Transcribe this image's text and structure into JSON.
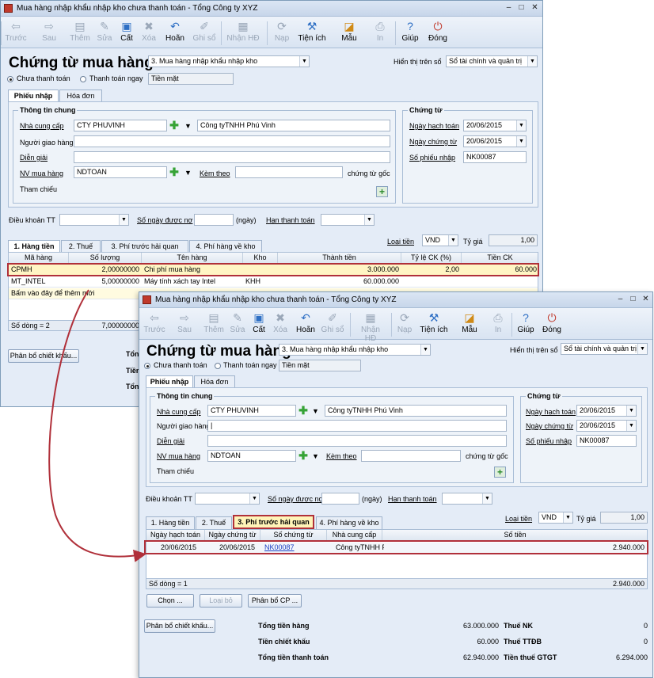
{
  "window_title": "Mua hàng nhập khẩu nhập kho chưa thanh toán - Tổng Công ty XYZ",
  "toolbar": [
    {
      "label": "Trước",
      "icon": "arrow-left-icon",
      "enabled": false
    },
    {
      "label": "Sau",
      "icon": "arrow-right-icon",
      "enabled": false
    },
    {
      "label": "Thêm",
      "icon": "new-document-icon",
      "enabled": false
    },
    {
      "label": "Sửa",
      "icon": "edit-icon",
      "enabled": false
    },
    {
      "label": "Cất",
      "icon": "save-icon",
      "enabled": true
    },
    {
      "label": "Xóa",
      "icon": "delete-icon",
      "enabled": false
    },
    {
      "label": "Hoãn",
      "icon": "undo-icon",
      "enabled": true
    },
    {
      "label": "Ghi sổ",
      "icon": "post-icon",
      "enabled": false
    },
    {
      "label": "Nhận HĐ",
      "icon": "receive-invoice-icon",
      "enabled": false
    },
    {
      "label": "Nạp",
      "icon": "reload-icon",
      "enabled": false
    },
    {
      "label": "Tiện ích",
      "icon": "utilities-icon",
      "enabled": true
    },
    {
      "label": "Mẫu",
      "icon": "template-icon",
      "enabled": true
    },
    {
      "label": "In",
      "icon": "print-icon",
      "enabled": false
    },
    {
      "label": "Giúp",
      "icon": "help-icon",
      "enabled": true
    },
    {
      "label": "Đóng",
      "icon": "close-icon",
      "enabled": true
    }
  ],
  "form": {
    "title": "Chứng từ mua hàng",
    "type_value": "3. Mua hàng nhập khẩu nhập kho",
    "display_label": "Hiển thị trên sổ",
    "display_value": "Sổ tài chính và quản trị",
    "radio_unpaid": "Chưa thanh toán",
    "radio_paid": "Thanh toán ngay",
    "payment_method": "Tiền mặt",
    "tab_receipt": "Phiếu nhập",
    "tab_invoice": "Hóa đơn",
    "general_info": "Thông tin chung",
    "voucher_group": "Chứng từ",
    "supplier_label": "Nhà cung cấp",
    "supplier_code": "CTY PHUVINH",
    "supplier_name": "Công tyTNHH Phú Vinh",
    "deliverer_label": "Người giao hàng",
    "description_label": "Diễn giải",
    "staff_label": "NV mua hàng",
    "staff_value": "NDTOAN",
    "attach_label": "Kèm theo",
    "original_docs_label": "chứng từ gốc",
    "reference_label": "Tham chiếu",
    "accounting_date_label": "Ngày hạch toán",
    "accounting_date": "20/06/2015",
    "voucher_date_label": "Ngày chứng từ",
    "voucher_date": "20/06/2015",
    "receipt_no_label": "Số phiếu nhập",
    "receipt_no": "NK00087",
    "terms_label": "Điều khoản TT",
    "credit_days_label": "Số ngày được nợ",
    "days_unit": "(ngày)",
    "due_date_label": "Hạn thanh toán",
    "currency_label": "Loại tiền",
    "currency": "VND",
    "rate_label": "Tỷ giá",
    "rate": "1,00"
  },
  "detail_tabs": [
    "1. Hàng tiền",
    "2. Thuế",
    "3. Phí trước hải quan",
    "4. Phí hàng về kho"
  ],
  "goods_grid": {
    "headers": [
      "Mã hàng",
      "Số lượng",
      "Tên hàng",
      "Kho",
      "Thành tiền",
      "Tỷ lệ CK (%)",
      "Tiền CK"
    ],
    "rows": [
      [
        "CPMH",
        "2,00000000",
        "Chi phí mua hàng",
        "",
        "3.000.000",
        "2,00",
        "60.000"
      ],
      [
        "MT_INTEL",
        "5,00000000",
        "Máy tính xách tay Intel",
        "KHH",
        "60.000.000",
        "",
        ""
      ]
    ],
    "add_hint": "Bấm vào đây để thêm mới",
    "row_count": "Số dòng = 2",
    "qty_total": "7,00000000"
  },
  "customs_grid": {
    "headers": [
      "Ngày hạch toán",
      "Ngày chứng từ",
      "Số chứng từ",
      "Nhà cung cấp",
      "Số tiền"
    ],
    "rows": [
      [
        "20/06/2015",
        "20/06/2015",
        "NK00087",
        "Công tyTNHH P",
        "2.940.000"
      ]
    ],
    "row_count": "Số dòng = 1",
    "amount_total": "2.940.000"
  },
  "buttons": {
    "choose": "Chọn ...",
    "remove": "Loại bỏ",
    "allocate_cost": "Phân bổ CP ...",
    "allocate_discount": "Phân bổ chiết khấu..."
  },
  "totals": {
    "goods_label": "Tổng tiền hàng",
    "goods": "63.000.000",
    "discount_label": "Tiền chiết khấu",
    "discount": "60.000",
    "payment_label": "Tổng tiền thanh toán",
    "payment": "62.940.000",
    "import_tax_label": "Thuế NK",
    "import_tax": "0",
    "excise_tax_label": "Thuế TTĐB",
    "excise_tax": "0",
    "vat_label": "Tiền thuế GTGT",
    "vat": "6.294.000"
  },
  "truncated_labels": {
    "t1": "Tổn",
    "t2": "Tiền",
    "t3": "Tổn"
  }
}
